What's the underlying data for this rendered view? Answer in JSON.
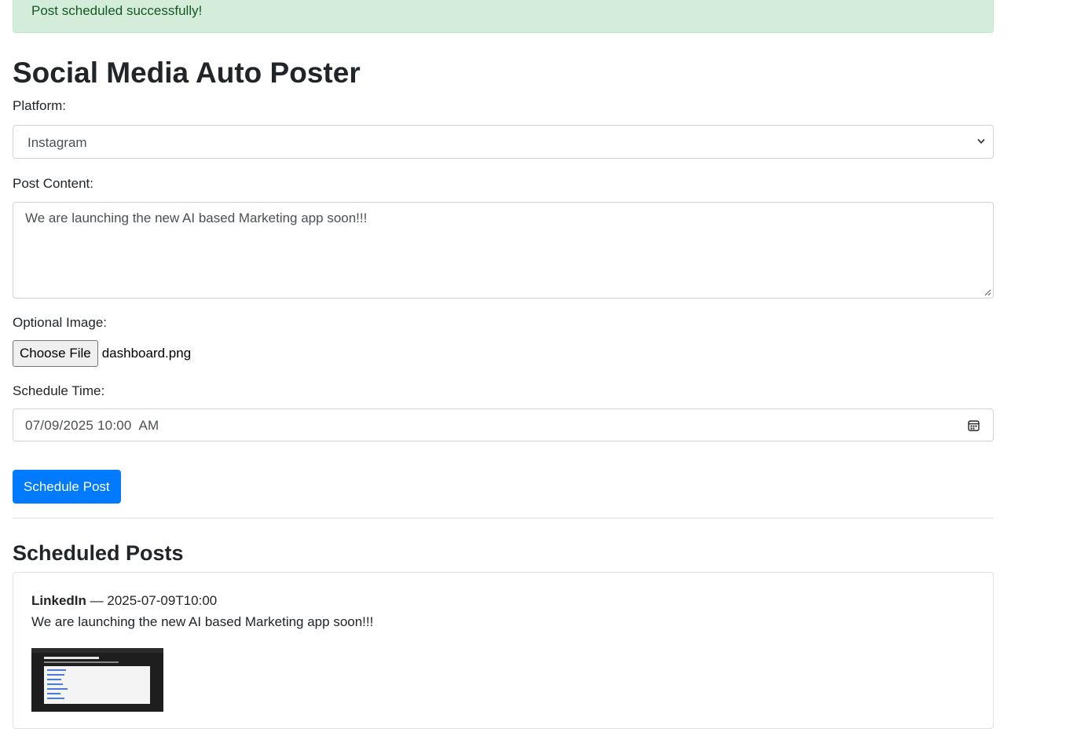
{
  "alert": {
    "message": "Post scheduled successfully!"
  },
  "page": {
    "title": "Social Media Auto Poster"
  },
  "form": {
    "platform_label": "Platform:",
    "platform_value": "Instagram",
    "content_label": "Post Content:",
    "content_value": "We are launching the new AI based Marketing app soon!!!",
    "image_label": "Optional Image:",
    "file_button": "Choose File",
    "file_name": "dashboard.png",
    "time_label": "Schedule Time:",
    "time_value": "07/09/2025 10:00  AM",
    "submit_label": "Schedule Post"
  },
  "scheduled": {
    "heading": "Scheduled Posts",
    "posts": [
      {
        "platform": "LinkedIn",
        "separator": " — ",
        "datetime": "2025-07-09T10:00",
        "content": "We are launching the new AI based Marketing app soon!!!"
      }
    ]
  },
  "colors": {
    "alert_bg": "#d4edda",
    "alert_text": "#155724",
    "primary": "#007bff",
    "border": "#ced4da"
  },
  "icons": {
    "select_arrow": "chevron-down-icon",
    "calendar": "calendar-icon",
    "resize": "resize-handle-icon"
  }
}
